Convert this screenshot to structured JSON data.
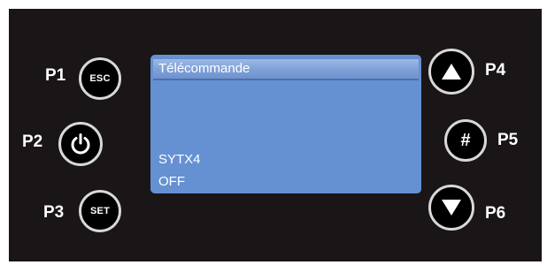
{
  "buttons": {
    "p1": {
      "label": "P1",
      "text": "ESC"
    },
    "p2": {
      "label": "P2"
    },
    "p3": {
      "label": "P3",
      "text": "SET"
    },
    "p4": {
      "label": "P4"
    },
    "p5": {
      "label": "P5",
      "text": "#"
    },
    "p6": {
      "label": "P6"
    }
  },
  "icons": {
    "p2": "power-icon",
    "p4": "arrow-up-icon",
    "p6": "arrow-down-icon"
  },
  "screen": {
    "title": "Télécommande",
    "line1": "SYTX4",
    "line2": "OFF"
  },
  "colors": {
    "panel": "#1a1516",
    "screen": "#6591d3",
    "button_border": "#d8d8d8"
  }
}
